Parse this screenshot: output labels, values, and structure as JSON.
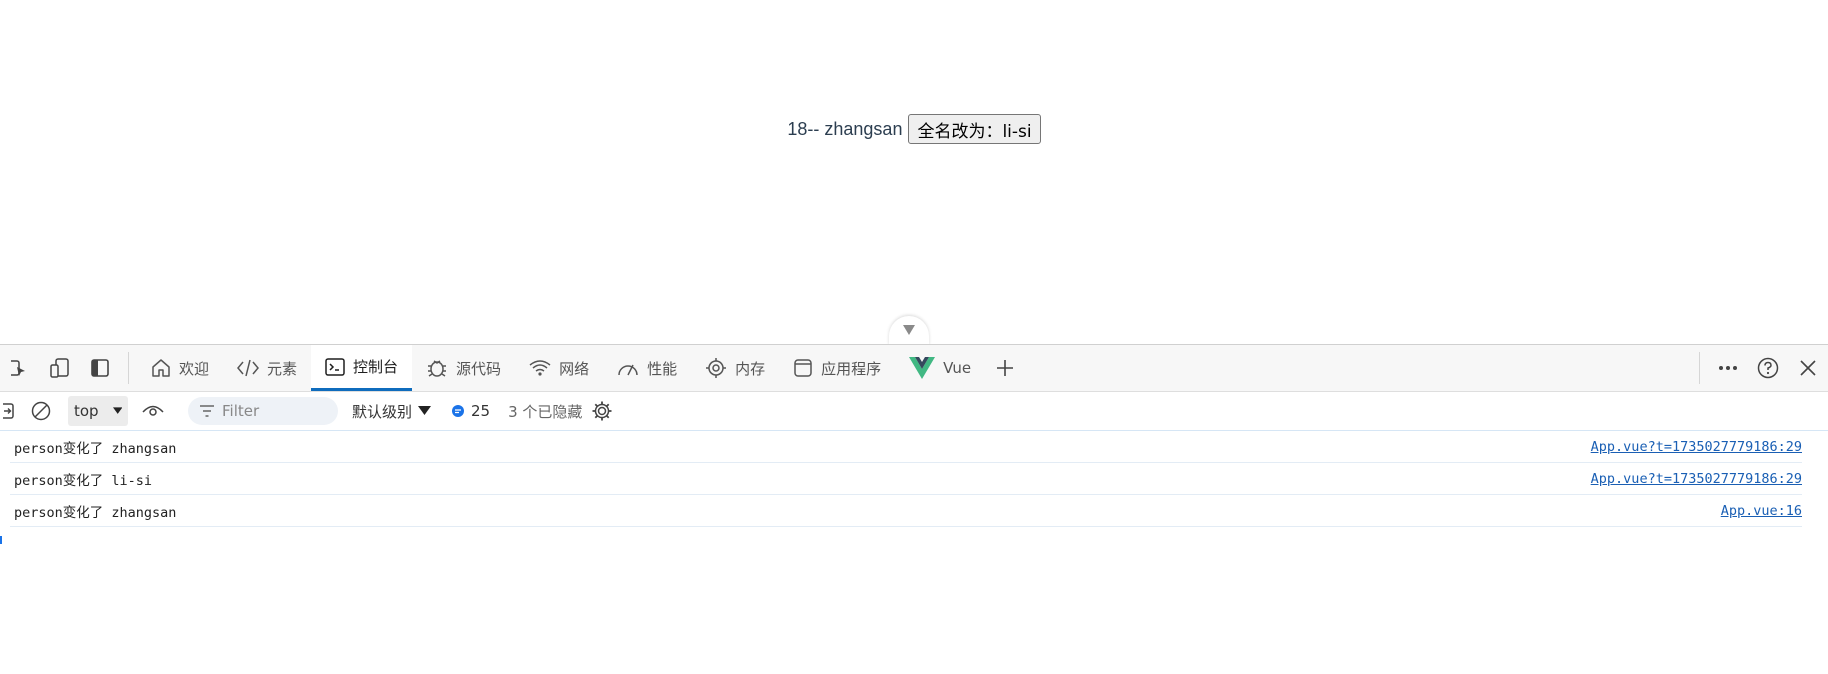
{
  "app": {
    "text": "18-- zhangsan",
    "button_label": "全名改为：li-si"
  },
  "devtools": {
    "tabs": [
      {
        "label": "欢迎",
        "icon": "home-icon"
      },
      {
        "label": "元素",
        "icon": "code-icon"
      },
      {
        "label": "控制台",
        "icon": "console-icon"
      },
      {
        "label": "源代码",
        "icon": "bug-icon"
      },
      {
        "label": "网络",
        "icon": "wifi-icon"
      },
      {
        "label": "性能",
        "icon": "gauge-icon"
      },
      {
        "label": "内存",
        "icon": "chip-icon"
      },
      {
        "label": "应用程序",
        "icon": "app-window-icon"
      },
      {
        "label": "Vue",
        "icon": "vue-logo-icon"
      }
    ],
    "active_tab": "控制台",
    "console_toolbar": {
      "context": "top",
      "filter_placeholder": "Filter",
      "log_level": "默认级别",
      "message_count": "25",
      "hidden": "3 个已隐藏"
    },
    "logs": [
      {
        "message": "person变化了 zhangsan",
        "source": "App.vue?t=1735027779186:29"
      },
      {
        "message": "person变化了 li-si",
        "source": "App.vue?t=1735027779186:29"
      },
      {
        "message": "person变化了 zhangsan",
        "source": "App.vue:16"
      }
    ],
    "colors": {
      "accent": "#0f6cbd",
      "link": "#1a5fb4",
      "vue_green": "#41b883",
      "vue_dark": "#35495e"
    }
  }
}
